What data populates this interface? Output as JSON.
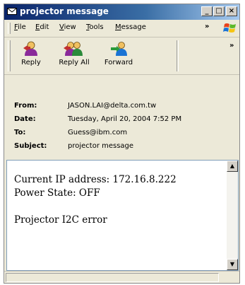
{
  "window": {
    "title": "projector message",
    "minimize": "_",
    "maximize": "□",
    "close": "×"
  },
  "menu": {
    "items": [
      "File",
      "Edit",
      "View",
      "Tools",
      "Message"
    ],
    "overflow": "»"
  },
  "toolbar": {
    "buttons": [
      "Reply",
      "Reply All",
      "Forward"
    ],
    "overflow": "»"
  },
  "header": {
    "from_label": "From:",
    "from_value": "JASON.LAI@delta.com.tw",
    "date_label": "Date:",
    "date_value": "Tuesday, April 20, 2004 7:52 PM",
    "to_label": "To:",
    "to_value": "Guess@ibm.com",
    "subject_label": "Subject:",
    "subject_value": "projector message"
  },
  "message": {
    "lines": [
      "Current IP address: 172.16.8.222",
      "Power State: OFF",
      "",
      "Projector I2C error"
    ]
  },
  "icons": {
    "window": "envelope-icon",
    "reply": "reply-icon",
    "reply_all": "reply-all-icon",
    "forward": "forward-icon",
    "windows_logo": "windows-logo-icon"
  },
  "colors": {
    "titlebar_start": "#0a246a",
    "titlebar_end": "#a6caf0",
    "chrome": "#ece9d8"
  }
}
